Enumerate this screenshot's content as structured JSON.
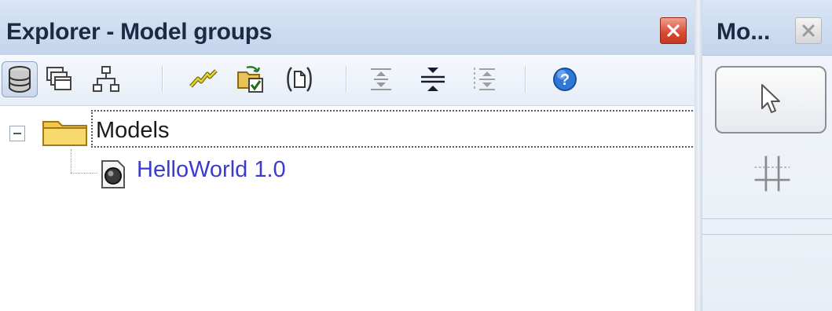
{
  "explorer": {
    "title": "Explorer - Model groups",
    "toolbar": {
      "buttons": [
        {
          "icon": "database-icon",
          "pressed": true
        },
        {
          "icon": "windows-icon"
        },
        {
          "icon": "hierarchy-icon"
        },
        {
          "icon": "lightning-icon"
        },
        {
          "icon": "open-check-icon"
        },
        {
          "icon": "document-bracket-icon"
        },
        {
          "icon": "expand-icon"
        },
        {
          "icon": "collapse-icon"
        },
        {
          "icon": "expand-all-icon"
        },
        {
          "icon": "help-icon"
        }
      ]
    },
    "tree": {
      "root_label": "Models",
      "child_label": "HelloWorld 1.0"
    }
  },
  "tools_panel": {
    "title": "Mo..."
  },
  "colors": {
    "title_bar": "#cddcf0",
    "link_text": "#3a3ccf",
    "close_red": "#d9482f"
  }
}
